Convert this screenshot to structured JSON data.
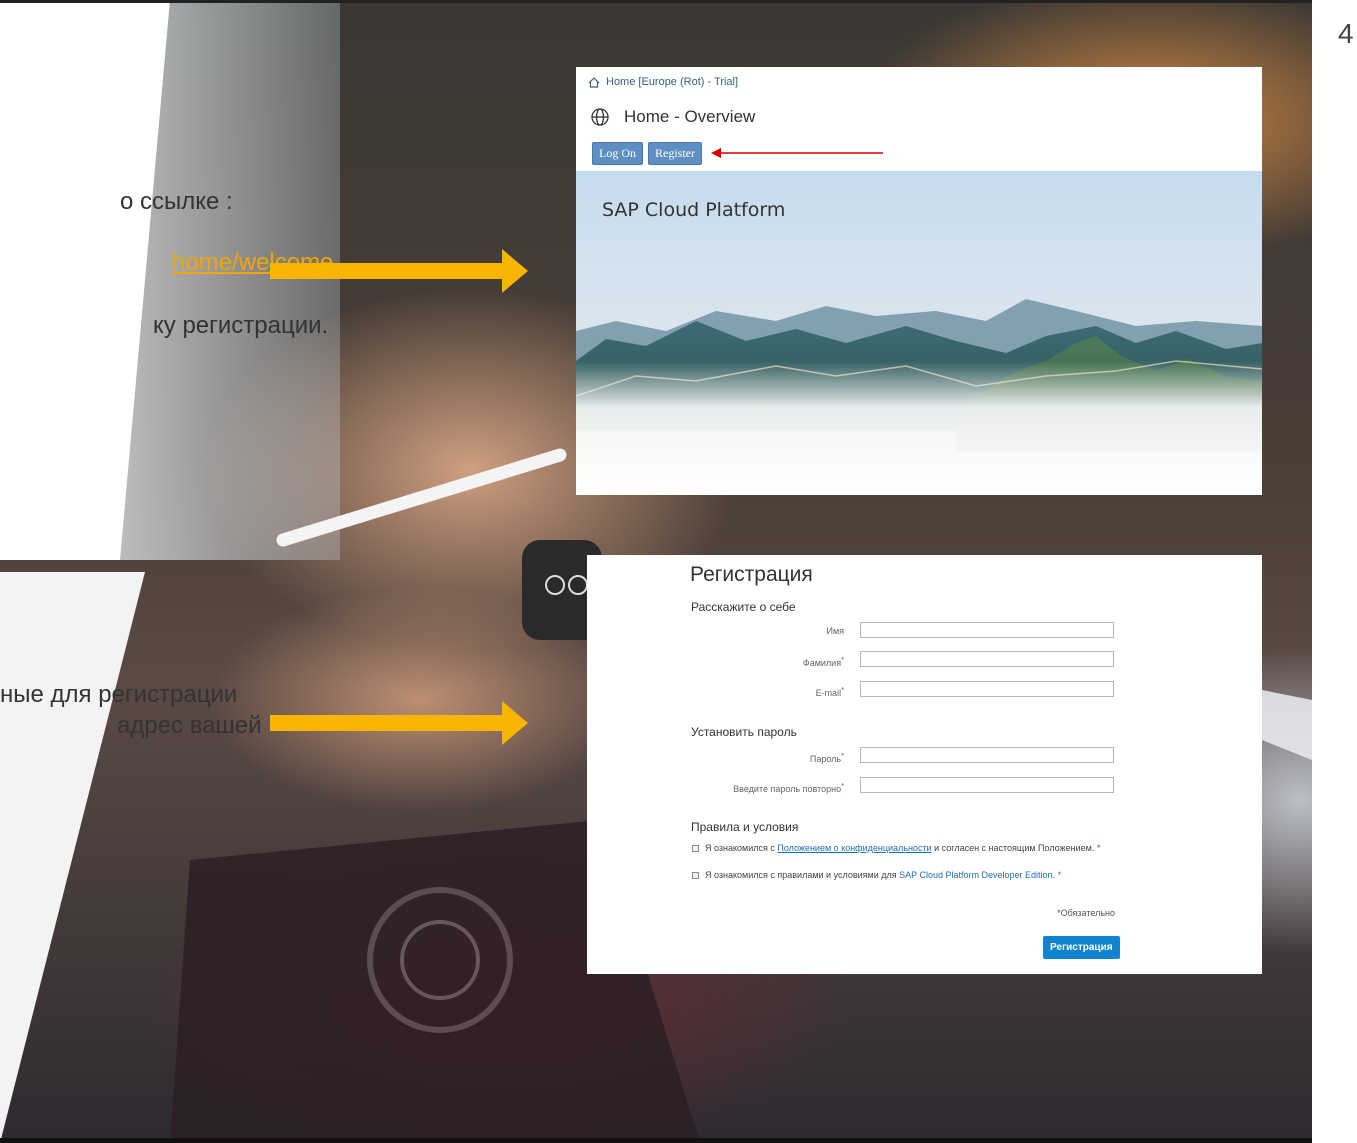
{
  "slide": {
    "page_number": "4",
    "text_line_1": "о ссылке :",
    "text_link": "home/welcome",
    "text_line_3": "ку регистрации.",
    "text_line_4": "ные для регистрации",
    "text_line_5": "адрес вашей"
  },
  "colors": {
    "arrow": "#f7b500",
    "link": "#f1a600",
    "sap_button": "#5d8fc2",
    "red_arrow": "#d90000",
    "register_button": "#1083d1"
  },
  "sap_window": {
    "breadcrumb": "Home [Europe (Rot) - Trial]",
    "breadcrumb_icon": "home-icon",
    "title": "Home - Overview",
    "title_icon": "globe-icon",
    "log_on_label": "Log On",
    "register_label": "Register",
    "hero_title": "SAP Cloud Platform"
  },
  "registration": {
    "title": "Регистрация",
    "section_about": "Расскажите о себе",
    "field_first_name": "Имя",
    "field_last_name": "Фамилия",
    "field_email": "E-mail",
    "section_password": "Установить пароль",
    "field_password": "Пароль",
    "field_password_repeat": "Введите пароль повторно",
    "required_mark": "*",
    "section_terms": "Правила и условия",
    "check1_prefix": "Я ознакомился с ",
    "check1_link": "Положением о конфиденциальности",
    "check1_suffix": " и согласен с настоящим Положением.",
    "check2_prefix": "Я ознакомился с правилами и условиями для ",
    "check2_link": "SAP Cloud Platform Developer Edition.",
    "required_note": "*Обязательно",
    "submit_label": "Регистрация"
  }
}
